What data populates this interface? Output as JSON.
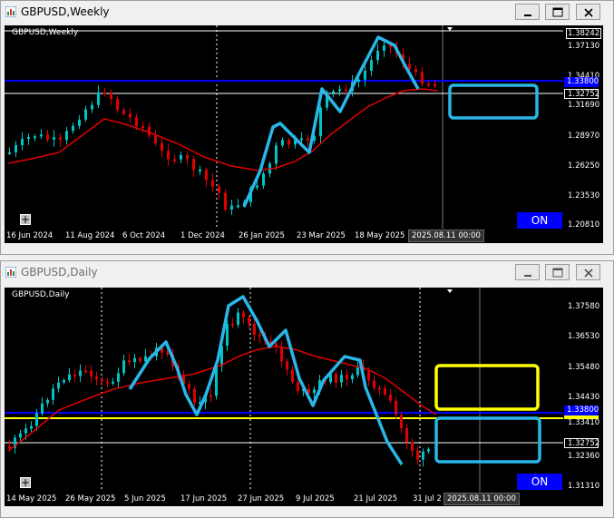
{
  "windows": [
    {
      "title": "GBPUSD,Weekly",
      "chart_label": "GBPUSD,Weekly",
      "active": true,
      "price_axis": [
        "1.38242",
        "1.37130",
        "1.34410",
        "1.33800",
        "1.32752",
        "1.31690",
        "1.28970",
        "1.26250",
        "1.23530",
        "1.20810"
      ],
      "hline_blue_label": "1.33800",
      "current_price_label": "1.32752",
      "date_axis": [
        "16 Jun 2024",
        "11 Aug 2024",
        "6 Oct 2024",
        "1 Dec 2024",
        "26 Jan 2025",
        "23 Mar 2025",
        "18 May 2025"
      ],
      "date_tag": "2025.08.11 00:00",
      "on_label": "ON",
      "plus_label": "+"
    },
    {
      "title": "GBPUSD,Daily",
      "chart_label": "GBPUSD,Daily",
      "active": false,
      "price_axis": [
        "1.37580",
        "1.36530",
        "1.35480",
        "1.34430",
        "1.33800",
        "1.33410",
        "1.32752",
        "1.32360",
        "1.31310"
      ],
      "hline_blue_label": "1.33800",
      "current_price_label": "1.32752",
      "date_axis": [
        "14 May 2025",
        "26 May 2025",
        "5 Jun 2025",
        "17 Jun 2025",
        "27 Jun 2025",
        "9 Jul 2025",
        "21 Jul 2025",
        "31 Jul 2"
      ],
      "date_tag": "2025.08.11 00:00",
      "on_label": "ON",
      "plus_label": "+"
    }
  ],
  "colors": {
    "bull": "#00c4c4",
    "bear": "#e00000",
    "ma": "#e00000",
    "hline_blue": "#0000ff",
    "hline_yellow": "#ffff00",
    "annotation_cyan": "#29b6e8",
    "annotation_yellow": "#ffff00"
  },
  "icons": [
    "chart-app-icon",
    "minimize-icon",
    "maximize-icon",
    "close-icon"
  ]
}
